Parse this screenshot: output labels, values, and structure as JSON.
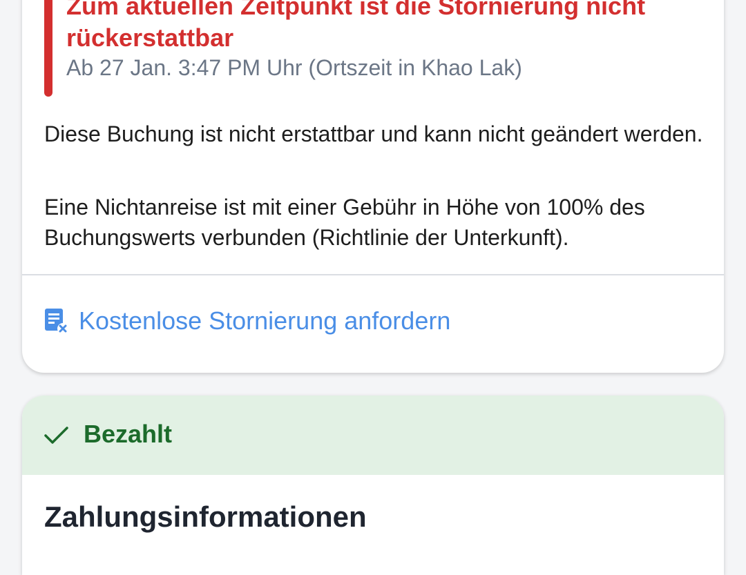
{
  "policy": {
    "title": "Zum aktuellen Zeitpunkt ist die Stornierung nicht rückerstattbar",
    "subtitle": "Ab 27 Jan. 3:47 PM Uhr (Ortszeit in Khao Lak)",
    "paragraph_1": "Diese Buchung ist nicht erstattbar und kann nicht geändert werden.",
    "paragraph_2": "Eine Nichtanreise ist mit einer Gebühr in Höhe von 100% des Buchungswerts verbunden (Richtlinie der Unterkunft).",
    "link_icon": "document-cancel-icon",
    "link_label": "Kostenlose Stornierung anfordern"
  },
  "payment": {
    "status_icon": "check-icon",
    "status_label": "Bezahlt",
    "heading": "Zahlungsinformationen"
  },
  "colors": {
    "alert_red": "#d32f2f",
    "link_blue": "#4a8ee6",
    "paid_green_text": "#1c6b2b",
    "paid_green_bg": "#e2f1e4"
  }
}
